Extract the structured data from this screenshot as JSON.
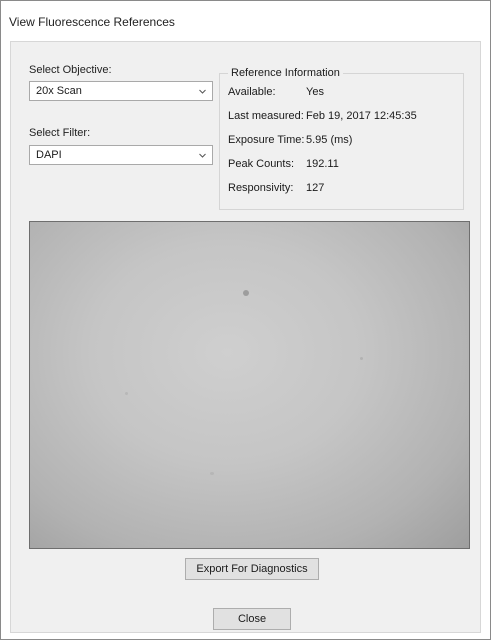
{
  "window": {
    "title": "View Fluorescence References"
  },
  "objective": {
    "label": "Select Objective:",
    "selected": "20x Scan"
  },
  "filter": {
    "label": "Select Filter:",
    "selected": "DAPI"
  },
  "reference_info": {
    "title": "Reference Information",
    "rows": [
      {
        "label": "Available:",
        "value": "Yes"
      },
      {
        "label": "Last measured:",
        "value": "Feb 19, 2017 12:45:35"
      },
      {
        "label": "Exposure Time:",
        "value": "5.95 (ms)"
      },
      {
        "label": "Peak Counts:",
        "value": "192.11"
      },
      {
        "label": "Responsivity:",
        "value": "127"
      }
    ]
  },
  "buttons": {
    "export_label": "Export For Diagnostics",
    "close_label": "Close"
  },
  "icons": {
    "objective_dropdown": "chevron-down-icon",
    "filter_dropdown": "chevron-down-icon"
  }
}
